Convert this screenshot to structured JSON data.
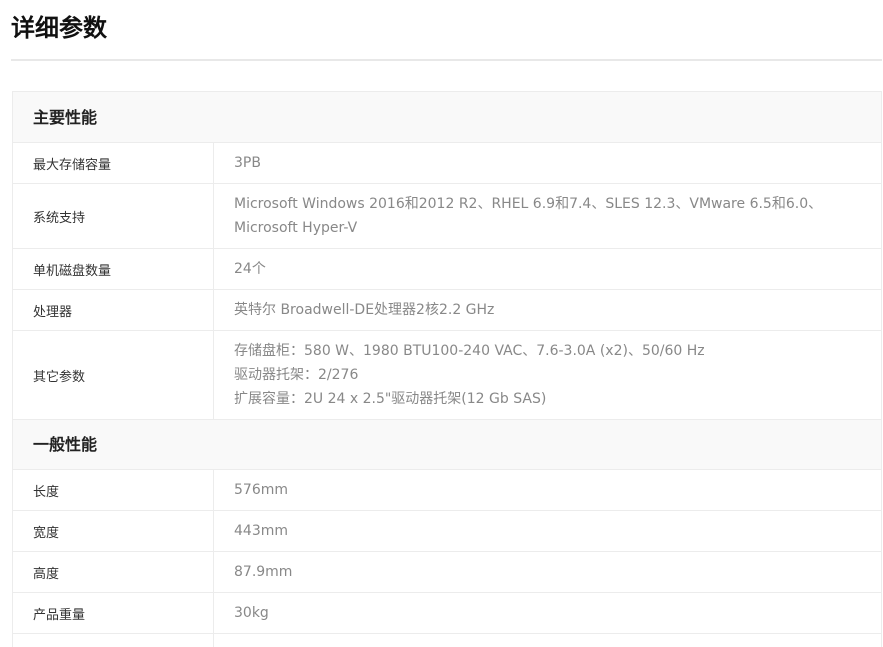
{
  "page": {
    "title": "详细参数"
  },
  "sections": [
    {
      "header": "主要性能",
      "rows": [
        {
          "label": "最大存储容量",
          "values": [
            "3PB"
          ]
        },
        {
          "label": "系统支持",
          "values": [
            "Microsoft Windows 2016和2012 R2、RHEL 6.9和7.4、SLES 12.3、VMware 6.5和6.0、Microsoft Hyper-V"
          ]
        },
        {
          "label": "单机磁盘数量",
          "values": [
            "24个"
          ]
        },
        {
          "label": "处理器",
          "values": [
            "英特尔 Broadwell-DE处理器2核2.2 GHz"
          ]
        },
        {
          "label": "其它参数",
          "values": [
            "存储盘柜：580 W、1980 BTU100-240 VAC、7.6-3.0A (x2)、50/60 Hz",
            "驱动器托架：2/276",
            "扩展容量：2U 24 x 2.5\"驱动器托架(12 Gb SAS)"
          ]
        }
      ]
    },
    {
      "header": "一般性能",
      "rows": [
        {
          "label": "长度",
          "values": [
            "576mm"
          ]
        },
        {
          "label": "宽度",
          "values": [
            "443mm"
          ]
        },
        {
          "label": "高度",
          "values": [
            "87.9mm"
          ]
        },
        {
          "label": "产品重量",
          "values": [
            "30kg"
          ]
        }
      ]
    }
  ]
}
